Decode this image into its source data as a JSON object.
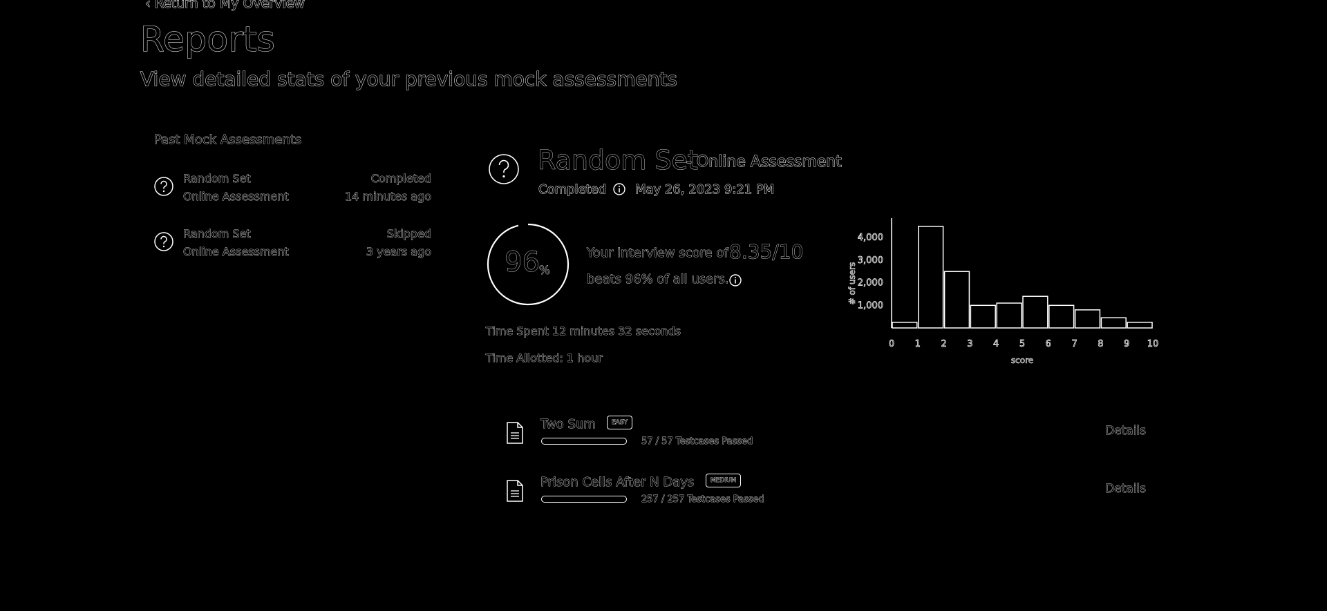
{
  "header": {
    "return_link": "‹ Return to My Overview",
    "title": "Reports",
    "subtitle": "View detailed stats of your previous mock assessments"
  },
  "past_assessments": {
    "heading": "Past Mock Assessments",
    "items": [
      {
        "name": "Random Set",
        "type": "Online Assessment",
        "status": "Completed",
        "time": "14 minutes ago"
      },
      {
        "name": "Random Set",
        "type": "Online Assessment",
        "status": "Skipped",
        "time": "3 years ago"
      }
    ]
  },
  "detail": {
    "title": "Random Set",
    "type": "- Online Assessment",
    "status": "Completed",
    "date": "May 26, 2023 9:21 PM",
    "percentile": "96",
    "percent_sign": "%",
    "percentile_fraction": 0.96,
    "score_prefix": "Your interview score of",
    "score_value": "8.35/10",
    "score_suffix": "beats 96% of all users.",
    "time_spent": "Time Spent  12 minutes 32 seconds",
    "time_allotted": "Time Allotted: 1 hour"
  },
  "chart_data": {
    "type": "bar",
    "x_ticks": [
      "0",
      "1",
      "2",
      "3",
      "4",
      "5",
      "6",
      "7",
      "8",
      "9",
      "10"
    ],
    "bins": [
      {
        "from": 0,
        "to": 1,
        "value": 250
      },
      {
        "from": 1,
        "to": 2,
        "value": 4500
      },
      {
        "from": 2,
        "to": 3,
        "value": 2500
      },
      {
        "from": 3,
        "to": 4,
        "value": 1000
      },
      {
        "from": 4,
        "to": 5,
        "value": 1100
      },
      {
        "from": 5,
        "to": 6,
        "value": 1400
      },
      {
        "from": 6,
        "to": 7,
        "value": 1000
      },
      {
        "from": 7,
        "to": 8,
        "value": 800
      },
      {
        "from": 8,
        "to": 9,
        "value": 450
      },
      {
        "from": 9,
        "to": 10,
        "value": 250
      }
    ],
    "y_ticks": [
      "1,000",
      "2,000",
      "3,000",
      "4,000"
    ],
    "ylim": [
      0,
      4800
    ],
    "xlim": [
      0,
      10
    ],
    "xlabel": "score",
    "ylabel": "# of users",
    "grid": false
  },
  "questions": [
    {
      "name": "Two Sum",
      "difficulty": "EASY",
      "testcases": "57 / 57 Testcases Passed",
      "pass_fraction": 1.0,
      "details": "Details"
    },
    {
      "name": "Prison Cells After N Days",
      "difficulty": "MEDIUM",
      "testcases": "257 / 257 Testcases Passed",
      "pass_fraction": 1.0,
      "details": "Details"
    }
  ],
  "icons": {
    "assessment": "question-circle-icon",
    "info": "info-circle-icon",
    "question": "document-icon"
  }
}
